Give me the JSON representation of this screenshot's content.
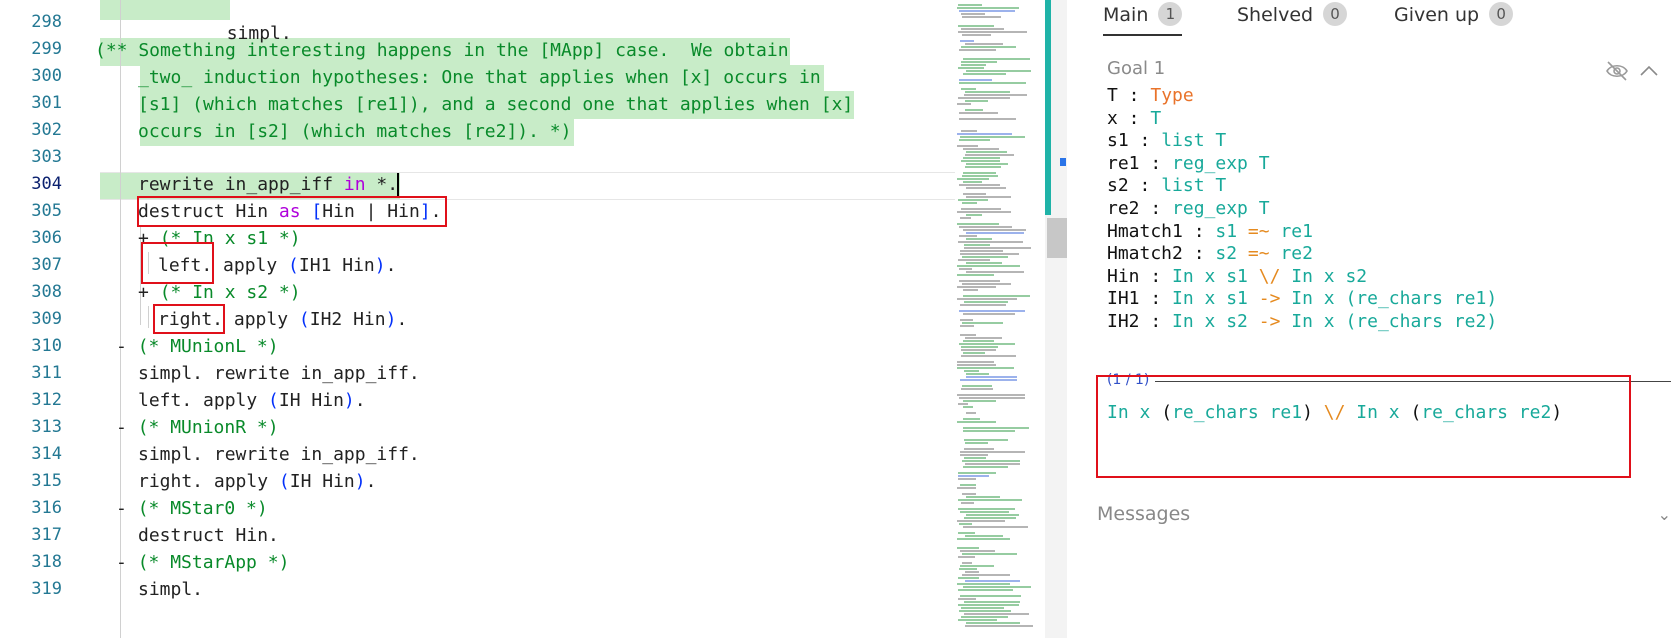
{
  "editor": {
    "line_numbers": [
      "298",
      "299",
      "300",
      "301",
      "302",
      "303",
      "304",
      "305",
      "306",
      "307",
      "308",
      "309",
      "310",
      "311",
      "312",
      "313",
      "314",
      "315",
      "316",
      "317",
      "318",
      "319"
    ],
    "active_line": "304",
    "lines": {
      "l298": "simpl.",
      "l299": "(** Something interesting happens in the [MApp] case.  We obtain",
      "l300": "_two_ induction hypotheses: One that applies when [x] occurs in",
      "l301": "[s1] (which matches [re1]), and a second one that applies when [x]",
      "l302": "occurs in [s2] (which matches [re2]). *)",
      "l304a": "rewrite in_app_iff ",
      "l304b": "in",
      "l304c": " *.",
      "l305a": "destruct Hin ",
      "l305b": "as",
      "l305c": " [",
      "l305d": "Hin | Hin",
      "l305e": "]",
      "l305f": ".",
      "l306a": "+ ",
      "l306b": "(* In x s1 *)",
      "l307a": "left.",
      "l307b": " apply ",
      "l307c": "(",
      "l307d": "IH1 Hin",
      "l307e": ")",
      "l307f": ".",
      "l308a": "+ ",
      "l308b": "(* In x s2 *)",
      "l309a": "right.",
      "l309b": " apply ",
      "l309c": "(",
      "l309d": "IH2 Hin",
      "l309e": ")",
      "l309f": ".",
      "l310a": "- ",
      "l310b": "(* MUnionL *)",
      "l311": "simpl. rewrite in_app_iff.",
      "l312a": "left. apply ",
      "l312b": "(",
      "l312c": "IH Hin",
      "l312d": ")",
      "l312e": ".",
      "l313a": "- ",
      "l313b": "(* MUnionR *)",
      "l314": "simpl. rewrite in_app_iff.",
      "l315a": "right. apply ",
      "l315b": "(",
      "l315c": "IH Hin",
      "l315d": ")",
      "l315e": ".",
      "l316a": "- ",
      "l316b": "(* MStar0 *)",
      "l317": "destruct Hin.",
      "l318a": "- ",
      "l318b": "(* MStarApp *)",
      "l319": "simpl."
    }
  },
  "panel": {
    "tabs": [
      {
        "label": "Main",
        "count": "1"
      },
      {
        "label": "Shelved",
        "count": "0"
      },
      {
        "label": "Given up",
        "count": "0"
      }
    ],
    "goal_title": "Goal 1",
    "hypotheses": [
      {
        "name": "T",
        "type": "Type"
      },
      {
        "name": "x",
        "type": "T"
      },
      {
        "name": "s1",
        "type": "list T"
      },
      {
        "name": "re1",
        "type": "reg_exp T"
      },
      {
        "name": "s2",
        "type": "list T"
      },
      {
        "name": "re2",
        "type": "reg_exp T"
      },
      {
        "name": "Hmatch1",
        "type_a": "s1",
        "op": "=~",
        "type_b": "re1"
      },
      {
        "name": "Hmatch2",
        "type_a": "s2",
        "op": "=~",
        "type_b": "re2"
      },
      {
        "name": "Hin",
        "type_a": "In x s1",
        "op": "\\/",
        "type_b": "In x s2"
      },
      {
        "name": "IH1",
        "type_a": "In x s1",
        "op": "->",
        "type_b": "In x (re_chars re1)"
      },
      {
        "name": "IH2",
        "type_a": "In x s2",
        "op": "->",
        "type_b": "In x (re_chars re2)"
      }
    ],
    "goal_count": "(1 / 1)",
    "goal": {
      "left_a": "In x ",
      "left_b": "(",
      "left_c": "re_chars re1",
      "left_d": ")",
      "op": " \\/ ",
      "right_a": "In x ",
      "right_b": "(",
      "right_c": "re_chars re2",
      "right_d": ")"
    },
    "messages_label": "Messages"
  },
  "colors": {
    "highlight": "#c8ecc8",
    "comment": "#098a2a",
    "keyword": "#af00db",
    "bracket": "#0431fa",
    "line_number": "#237893",
    "type_orange": "#e9732a",
    "teal": "#18a99a",
    "annotation_red": "#e0101a"
  },
  "icons": [
    "eye-slash-icon",
    "chevron-up-icon",
    "chevron-down-icon"
  ]
}
